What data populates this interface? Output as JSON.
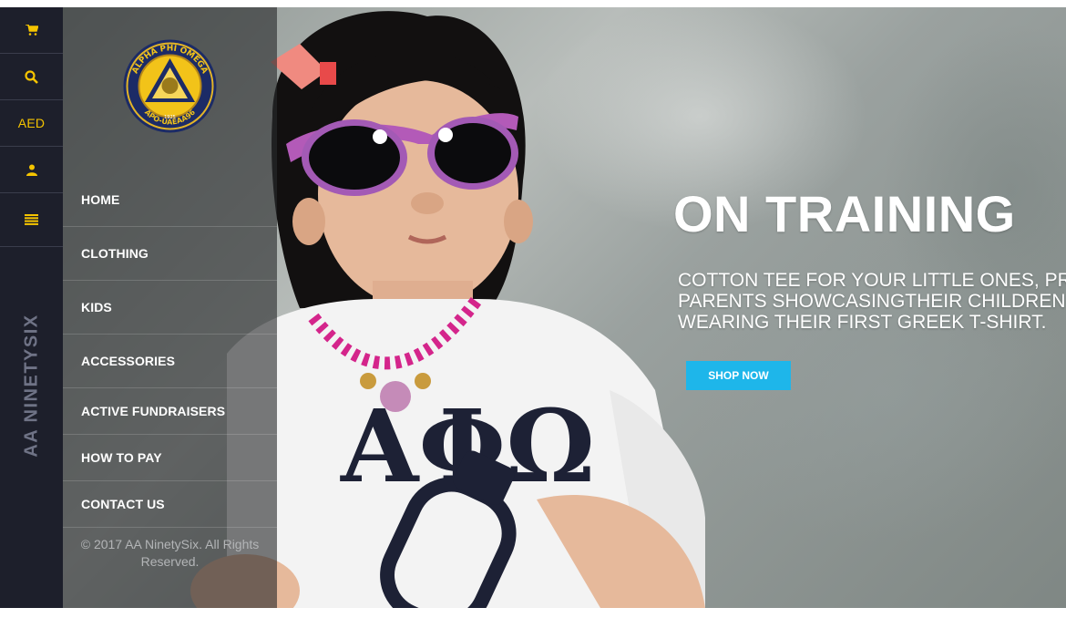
{
  "rail": {
    "currency": "AED",
    "vertical_brand": "AA NINETYSIX",
    "icons": [
      "cart-icon",
      "search-icon",
      "user-icon",
      "menu-list-icon"
    ]
  },
  "brand_logo": {
    "ring_top": "ALPHA PHI OMEGA",
    "ring_bottom": "APO-UAEAA96",
    "year": "1925"
  },
  "menu": [
    {
      "label": "HOME",
      "name": "home"
    },
    {
      "label": "CLOTHING",
      "name": "clothing"
    },
    {
      "label": "KIDS",
      "name": "kids"
    },
    {
      "label": "ACCESSORIES",
      "name": "accessories"
    },
    {
      "label": "ACTIVE FUNDRAISERS",
      "name": "active-fundraisers"
    },
    {
      "label": "HOW TO PAY",
      "name": "how-to-pay"
    },
    {
      "label": "CONTACT US",
      "name": "contact-us"
    }
  ],
  "copyright": {
    "line1": "© 2017 AA NinetySix. All Rights",
    "line2": "Reserved."
  },
  "hero": {
    "title": "ON TRAINING",
    "subtitle_lines": [
      "COTTON TEE FOR YOUR LITTLE ONES, PR",
      "PARENTS SHOWCASINGTHEIR CHILDREN",
      "WEARING THEIR FIRST GREEK T-SHIRT."
    ],
    "cta": "SHOP NOW",
    "shirt_print": "ΑΦΩ"
  },
  "colors": {
    "rail_bg": "#1d1f2b",
    "rail_accent": "#f5c400",
    "cta_bg": "#1eb6ea",
    "menu_text": "#ffffff"
  }
}
